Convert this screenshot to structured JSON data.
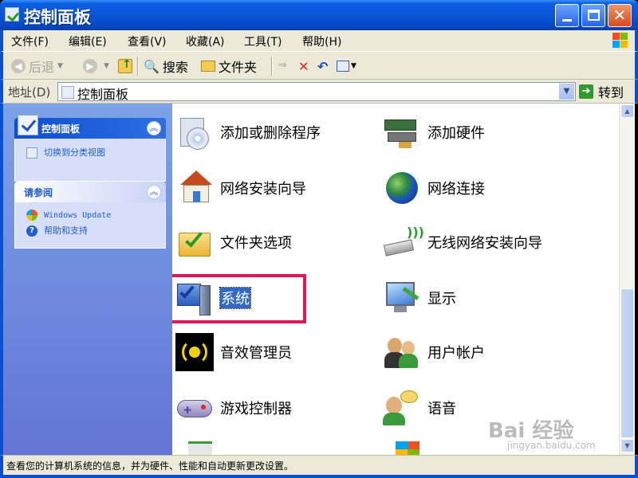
{
  "window": {
    "title": "控制面板"
  },
  "menu": [
    "文件(F)",
    "编辑(E)",
    "查看(V)",
    "收藏(A)",
    "工具(T)",
    "帮助(H)"
  ],
  "toolbar": {
    "back": "后退",
    "search": "搜索",
    "folders": "文件夹"
  },
  "address": {
    "label": "地址(D)",
    "value": "控制面板",
    "go": "转到"
  },
  "sidebar": {
    "cp_panel": {
      "title": "控制面板",
      "link": "切换到分类视图"
    },
    "see_also": {
      "title": "请参阅",
      "links": [
        "Windows Update",
        "帮助和支持"
      ]
    }
  },
  "items": [
    {
      "label": "添加或删除程序",
      "icon": "add-remove-programs-icon"
    },
    {
      "label": "添加硬件",
      "icon": "add-hardware-icon"
    },
    {
      "label": "网络安装向导",
      "icon": "network-setup-wizard-icon"
    },
    {
      "label": "网络连接",
      "icon": "network-connections-icon"
    },
    {
      "label": "文件夹选项",
      "icon": "folder-options-icon"
    },
    {
      "label": "无线网络安装向导",
      "icon": "wireless-network-setup-icon"
    },
    {
      "label": "系统",
      "icon": "system-icon",
      "selected": true
    },
    {
      "label": "显示",
      "icon": "display-icon"
    },
    {
      "label": "音效管理员",
      "icon": "sound-manager-icon"
    },
    {
      "label": "用户帐户",
      "icon": "user-accounts-icon"
    },
    {
      "label": "游戏控制器",
      "icon": "game-controllers-icon"
    },
    {
      "label": "语音",
      "icon": "speech-icon"
    }
  ],
  "statusbar": {
    "text": "查看您的计算机系统的信息，并为硬件、性能和自动更新更改设置。"
  },
  "watermark": {
    "text": "Bai 经验",
    "sub": "jingyan.baidu.com"
  },
  "colors": {
    "highlight": "#e0185a",
    "selection": "#316ac5",
    "titlebar": "#0a56d6"
  }
}
